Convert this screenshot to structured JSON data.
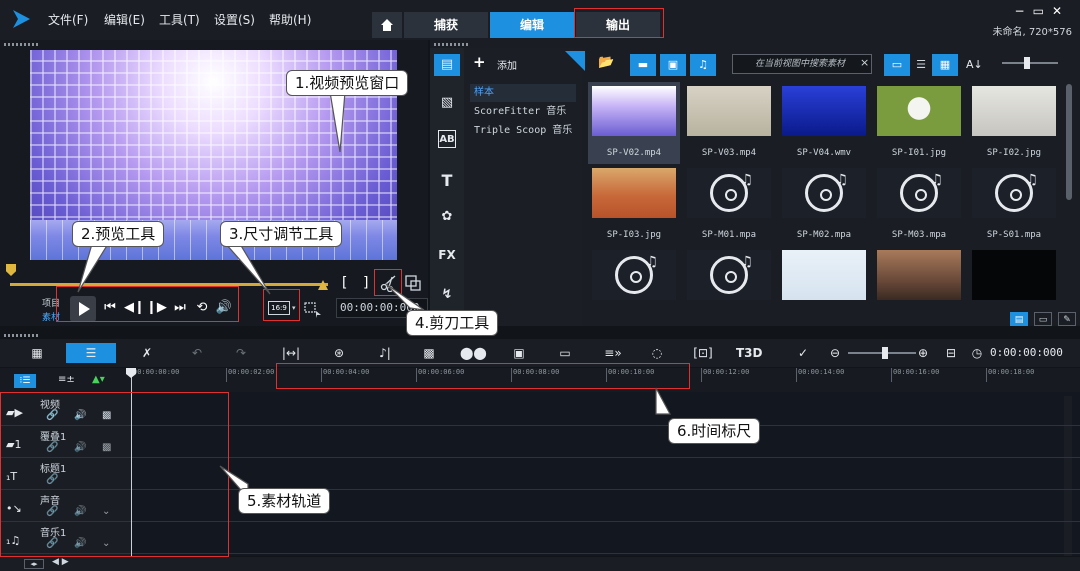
{
  "menu": {
    "file": "文件(F)",
    "edit": "编辑(E)",
    "tools": "工具(T)",
    "settings": "设置(S)",
    "help": "帮助(H)"
  },
  "tabs": {
    "home_icon": "home-icon",
    "capture": "捕获",
    "edit": "编辑",
    "share": "输出"
  },
  "window": {
    "project_info": "未命名, 720*576"
  },
  "preview": {
    "project_label": "项目",
    "clip_label": "素材",
    "ratio": "16:9",
    "timecode": "00:00:00:000",
    "mark_in": "[",
    "mark_out": "]"
  },
  "library": {
    "add_label": "添加",
    "folders": [
      "样本",
      "ScoreFitter 音乐",
      "Triple Scoop 音乐"
    ],
    "search_placeholder": "在当前视图中搜索素材",
    "search_clear": "×",
    "sort_icon": "A↓",
    "thumbs": [
      {
        "name": "SP-V02.mp4",
        "kind": "video-purple"
      },
      {
        "name": "SP-V03.mp4",
        "kind": "video-beige"
      },
      {
        "name": "SP-V04.wmv",
        "kind": "video-blue"
      },
      {
        "name": "SP-I01.jpg",
        "kind": "image-dandelion"
      },
      {
        "name": "SP-I02.jpg",
        "kind": "image-tree"
      },
      {
        "name": "SP-I03.jpg",
        "kind": "image-desert"
      },
      {
        "name": "SP-M01.mpa",
        "kind": "audio"
      },
      {
        "name": "SP-M02.mpa",
        "kind": "audio"
      },
      {
        "name": "SP-M03.mpa",
        "kind": "audio"
      },
      {
        "name": "SP-S01.mpa",
        "kind": "audio"
      },
      {
        "name": "",
        "kind": "audio"
      },
      {
        "name": "",
        "kind": "audio"
      },
      {
        "name": "",
        "kind": "card"
      },
      {
        "name": "",
        "kind": "photo-group"
      },
      {
        "name": "",
        "kind": "black"
      }
    ]
  },
  "timeline": {
    "timecode": "0:00:00:000",
    "ruler": [
      "00:00:00:00",
      "00:00:02:00",
      "00:00:04:00",
      "00:00:06:00",
      "00:00:08:00",
      "00:00:10:00",
      "00:00:12:00",
      "00:00:14:00",
      "00:00:16:00",
      "00:00:18:00"
    ],
    "tracks": [
      {
        "name": "视频"
      },
      {
        "name": "覆叠1"
      },
      {
        "name": "标题1"
      },
      {
        "name": "声音"
      },
      {
        "name": "音乐1"
      }
    ]
  },
  "annotations": {
    "preview_window": "1.视频预览窗口",
    "preview_tools": "2.预览工具",
    "size_tools": "3.尺寸调节工具",
    "scissors": "4.剪刀工具",
    "tracks": "5.素材轨道",
    "ruler": "6.时间标尺"
  },
  "colors": {
    "accent": "#1e90e0",
    "annotation": "#e03030",
    "scrub": "#d3a93a"
  }
}
